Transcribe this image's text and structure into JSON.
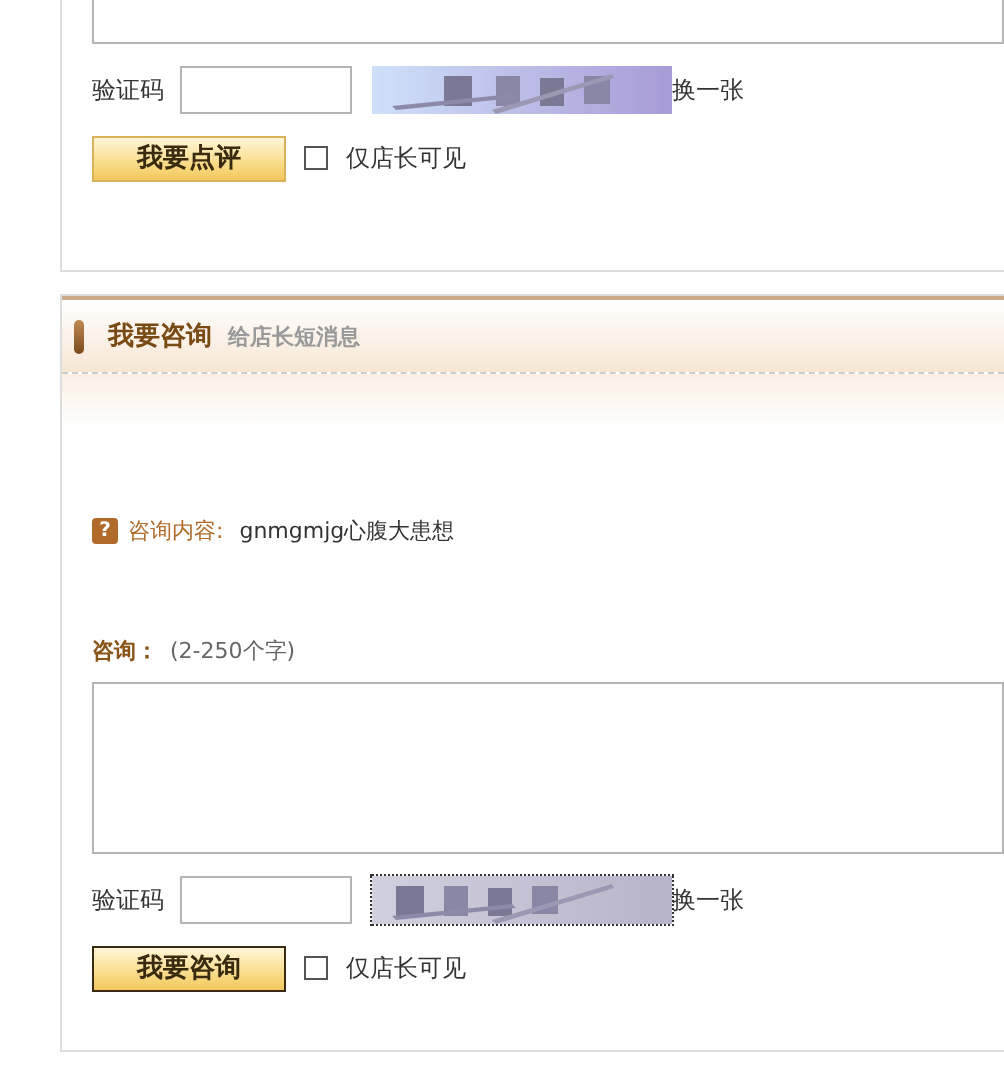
{
  "review_form": {
    "captcha_label": "验证码",
    "captcha_refresh": "换一张",
    "submit": "我要点评",
    "private_label": "仅店长可见",
    "private_checked": false
  },
  "consult_form": {
    "title": "我要咨询",
    "subtitle": "给店长短消息",
    "question_icon": "?",
    "question_label": "咨询内容:",
    "question_text": "gnmgmjg心腹大患想",
    "field_label": "咨询：",
    "field_hint": "(2-250个字)",
    "captcha_label": "验证码",
    "captcha_refresh": "换一张",
    "submit": "我要咨询",
    "private_label": "仅店长可见",
    "private_checked": false
  }
}
